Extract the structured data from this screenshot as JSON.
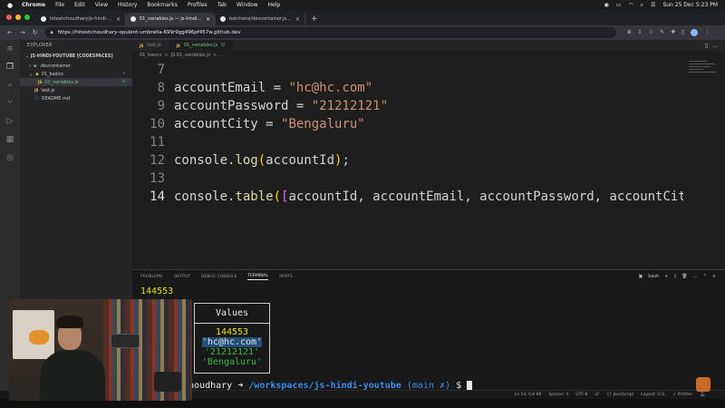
{
  "menubar": {
    "app": "Chrome",
    "items": [
      "File",
      "Edit",
      "View",
      "History",
      "Bookmarks",
      "Profiles",
      "Tab",
      "Window",
      "Help"
    ],
    "datetime": "Sun 25 Dec 5:23 PM"
  },
  "browser": {
    "tabs": [
      {
        "label": "hiteshchoudhary/js-hindi-youtube",
        "active": false
      },
      {
        "label": "01_variables.js — js-hindi-youtube",
        "active": true
      },
      {
        "label": "batchone/devcontainer.json at ...",
        "active": false
      }
    ],
    "url": "https://hiteshchoudhary-opulent-umbrella-699r9gg496pf457w.github.dev"
  },
  "sidebar": {
    "title": "EXPLORER",
    "section": "JS-HINDI-YOUTUBE [CODESPACES]",
    "tree": [
      {
        "label": ".devcontainer",
        "depth": 1,
        "kind": "folder"
      },
      {
        "label": "01_basics",
        "depth": 1,
        "kind": "folder-open",
        "mark": "•"
      },
      {
        "label": "01_variables.js",
        "depth": 2,
        "kind": "js",
        "mark": "U",
        "selected": true
      },
      {
        "label": "test.js",
        "depth": 1,
        "kind": "js"
      },
      {
        "label": "README.md",
        "depth": 1,
        "kind": "md"
      }
    ]
  },
  "editor": {
    "tabs": [
      {
        "label": "test.js",
        "badge": "JS",
        "active": false,
        "mod": ""
      },
      {
        "label": "01_variables.js",
        "badge": "JS",
        "active": true,
        "mod": "U"
      }
    ],
    "breadcrumb": [
      "01_basics",
      ">",
      "JS 01_variables.js",
      ">",
      "..."
    ],
    "lines": [
      {
        "n": "7",
        "text": ""
      },
      {
        "n": "8",
        "text": "accountEmail = \"hc@hc.com\""
      },
      {
        "n": "9",
        "text": "accountPassword = \"21212121\""
      },
      {
        "n": "10",
        "text": "accountCity = \"Bengaluru\""
      },
      {
        "n": "11",
        "text": ""
      },
      {
        "n": "12",
        "text": "console.log(accountId);"
      },
      {
        "n": "13",
        "text": ""
      },
      {
        "n": "14",
        "text": "console.table([accountId, accountEmail, accountPassword, accountCity]"
      }
    ],
    "current_line": "14"
  },
  "panel": {
    "tabs": [
      "PROBLEMS",
      "OUTPUT",
      "DEBUG CONSOLE",
      "TERMINAL",
      "PORTS"
    ],
    "active_tab": "TERMINAL",
    "shell": "bash",
    "output_line": "144553",
    "table_header": "Values",
    "table_values": [
      "144553",
      "'hc@hc.com'",
      "'21212121'",
      "'Bengaluru'"
    ],
    "prompt_user": "choudhary",
    "prompt_arrow": "➜",
    "prompt_path": "/workspaces/js-hindi-youtube",
    "prompt_git": "(main ✗)",
    "prompt_symbol": "$"
  },
  "statusbar": {
    "items": [
      "Ln 14, Col 69",
      "Spaces: 4",
      "UTF-8",
      "LF",
      "{} JavaScript",
      "Layout: U.S.",
      "✓ Prettier"
    ]
  }
}
